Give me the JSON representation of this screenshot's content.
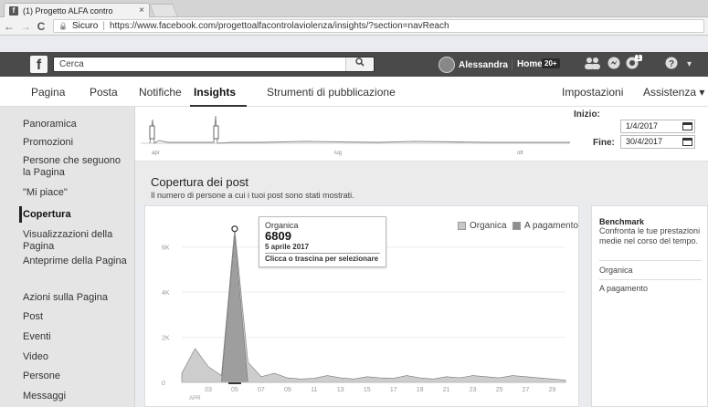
{
  "browser": {
    "tab_title": "(1) Progetto ALFA contro",
    "tab_close": "×",
    "back": "←",
    "forward": "→",
    "reload": "C",
    "secure_label": "Sicuro",
    "url": "https://www.facebook.com/progettoalfacontrolaviolenza/insights/?section=navReach"
  },
  "fbbar": {
    "logo": "f",
    "search_placeholder": "Cerca",
    "search_icon": "search-icon",
    "user_name": "Alessandra",
    "home_label": "Home",
    "home_badge": "20+",
    "notif_badge": "1"
  },
  "pagenav": {
    "items": [
      "Pagina",
      "Posta",
      "Notifiche",
      "Insights",
      "Strumenti di pubblicazione"
    ],
    "active": "Insights",
    "settings": "Impostazioni",
    "help": "Assistenza ▾"
  },
  "sidebar": {
    "items": [
      "Panoramica",
      "Promozioni",
      "Persone che seguono la Pagina",
      "\"Mi piace\"",
      "Copertura",
      "Visualizzazioni della Pagina",
      "Anteprime della Pagina",
      "Azioni sulla Pagina",
      "Post",
      "Eventi",
      "Video",
      "Persone",
      "Messaggi"
    ],
    "active": "Copertura"
  },
  "range": {
    "start_label": "Inizio:",
    "start_value": "1/4/2017",
    "end_label": "Fine:",
    "end_value": "30/4/2017",
    "mini_ticks": [
      "apr",
      "lug",
      "ott"
    ]
  },
  "section": {
    "title": "Copertura dei post",
    "subtitle": "Il numero di persone a cui i tuoi post sono stati mostrati."
  },
  "chart_data": {
    "type": "area",
    "title": "",
    "x_ticks": [
      "03",
      "05",
      "07",
      "09",
      "11",
      "13",
      "15",
      "17",
      "19",
      "21",
      "23",
      "25",
      "27",
      "29"
    ],
    "x_month": "APR",
    "y_ticks": [
      "0",
      "2K",
      "4K",
      "6K"
    ],
    "ylim": [
      0,
      7000
    ],
    "days": [
      1,
      2,
      3,
      4,
      5,
      6,
      7,
      8,
      9,
      10,
      11,
      12,
      13,
      14,
      15,
      16,
      17,
      18,
      19,
      20,
      21,
      22,
      23,
      24,
      25,
      26,
      27,
      28,
      29,
      30
    ],
    "series": [
      {
        "name": "Organica",
        "color": "#c8c8c8",
        "values": [
          400,
          1500,
          700,
          300,
          6809,
          900,
          250,
          400,
          200,
          150,
          180,
          300,
          200,
          150,
          250,
          200,
          180,
          300,
          200,
          150,
          250,
          200,
          300,
          250,
          200,
          300,
          250,
          200,
          150,
          100
        ]
      },
      {
        "name": "A pagamento",
        "color": "#8e8e8e",
        "values": [
          0,
          0,
          0,
          0,
          6500,
          0,
          0,
          0,
          0,
          0,
          0,
          0,
          0,
          0,
          0,
          0,
          0,
          0,
          0,
          0,
          0,
          0,
          0,
          0,
          0,
          0,
          0,
          0,
          0,
          0
        ]
      }
    ],
    "legend": [
      "Organica",
      "A pagamento"
    ],
    "legend_position": "top-right",
    "highlight": {
      "day": 5,
      "label": "Organica",
      "value": "6809",
      "date": "5 aprile 2017",
      "hint": "Clicca o trascina per selezionare"
    }
  },
  "benchmark": {
    "title": "Benchmark",
    "desc": "Confronta le tue prestazioni medie nel corso del tempo.",
    "rows": [
      "Organica",
      "A pagamento"
    ]
  }
}
